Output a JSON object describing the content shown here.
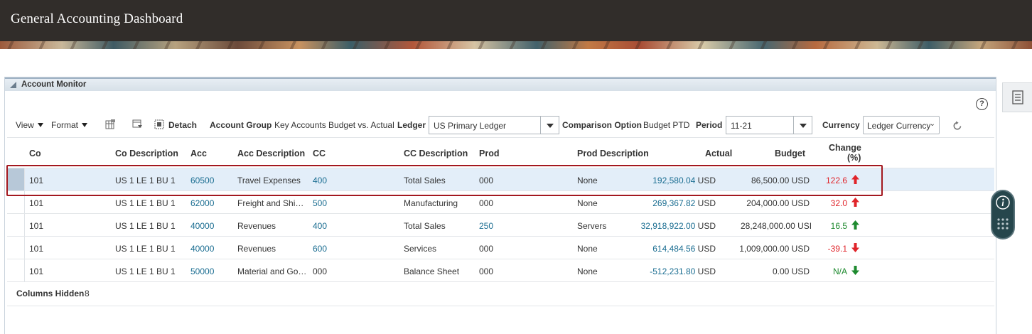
{
  "app": {
    "title": "General Accounting Dashboard"
  },
  "panel": {
    "title": "Account Monitor"
  },
  "toolbar": {
    "view_label": "View",
    "format_label": "Format",
    "detach_label": "Detach",
    "account_group_label": "Account Group",
    "account_group_value": "Key Accounts Budget vs. Actual",
    "ledger_label": "Ledger",
    "ledger_value": "US Primary Ledger",
    "comparison_label": "Comparison Option",
    "comparison_value": "Budget PTD",
    "period_label": "Period",
    "period_value": "11-21",
    "currency_label": "Currency",
    "currency_value": "Ledger Currency"
  },
  "table": {
    "headers": {
      "co": "Co",
      "co_desc": "Co Description",
      "acc": "Acc",
      "acc_desc": "Acc Description",
      "cc": "CC",
      "cc_desc": "CC Description",
      "prod": "Prod",
      "prod_desc": "Prod Description",
      "actual": "Actual",
      "budget": "Budget",
      "change_1": "Change",
      "change_2": "(%)"
    },
    "rows": [
      {
        "co": "101",
        "co_desc": "US 1 LE 1 BU 1",
        "acc": "60500",
        "acc_desc": "Travel Expenses",
        "cc": "400",
        "cc_desc": "Total Sales",
        "prod": "000",
        "prod_desc": "None",
        "actual": "192,580.04",
        "actual_cur": "USD",
        "budget": "86,500.00 USD",
        "change": "122.6",
        "trend": "up-unfavorable"
      },
      {
        "co": "101",
        "co_desc": "US 1 LE 1 BU 1",
        "acc": "62000",
        "acc_desc": "Freight and Shi…",
        "cc": "500",
        "cc_desc": "Manufacturing",
        "prod": "000",
        "prod_desc": "None",
        "actual": "269,367.82",
        "actual_cur": "USD",
        "budget": "204,000.00 USD",
        "change": "32.0",
        "trend": "up-unfavorable"
      },
      {
        "co": "101",
        "co_desc": "US 1 LE 1 BU 1",
        "acc": "40000",
        "acc_desc": "Revenues",
        "cc": "400",
        "cc_desc": "Total Sales",
        "prod": "250",
        "prod_desc": "Servers",
        "actual": "32,918,922.00",
        "actual_cur": "USD",
        "budget": "28,248,000.00 USI",
        "change": "16.5",
        "trend": "up-favorable"
      },
      {
        "co": "101",
        "co_desc": "US 1 LE 1 BU 1",
        "acc": "40000",
        "acc_desc": "Revenues",
        "cc": "600",
        "cc_desc": "Services",
        "prod": "000",
        "prod_desc": "None",
        "actual": "614,484.56",
        "actual_cur": "USD",
        "budget": "1,009,000.00 USD",
        "change": "-39.1",
        "trend": "down-unfavorable"
      },
      {
        "co": "101",
        "co_desc": "US 1 LE 1 BU 1",
        "acc": "50000",
        "acc_desc": "Material and Go…",
        "cc": "000",
        "cc_desc": "Balance Sheet",
        "prod": "000",
        "prod_desc": "None",
        "actual": "-512,231.80",
        "actual_cur": "USD",
        "budget": "0.00 USD",
        "change": "N/A",
        "trend": "down-favorable"
      }
    ],
    "footer_label": "Columns Hidden",
    "footer_count": "8"
  },
  "colors": {
    "header_bg": "#312d2a",
    "link": "#1a6d91",
    "negative": "#e0242a",
    "positive": "#1e8a2f",
    "selection_outline": "#a3181f",
    "selected_row": "#e3eef9"
  },
  "icons": [
    "collapse-triangle-icon",
    "help-icon",
    "freeze-icon",
    "wrap-icon",
    "detach-icon",
    "refresh-icon",
    "trend-up-icon",
    "trend-down-icon",
    "document-icon",
    "info-icon",
    "dots-grid-icon"
  ]
}
